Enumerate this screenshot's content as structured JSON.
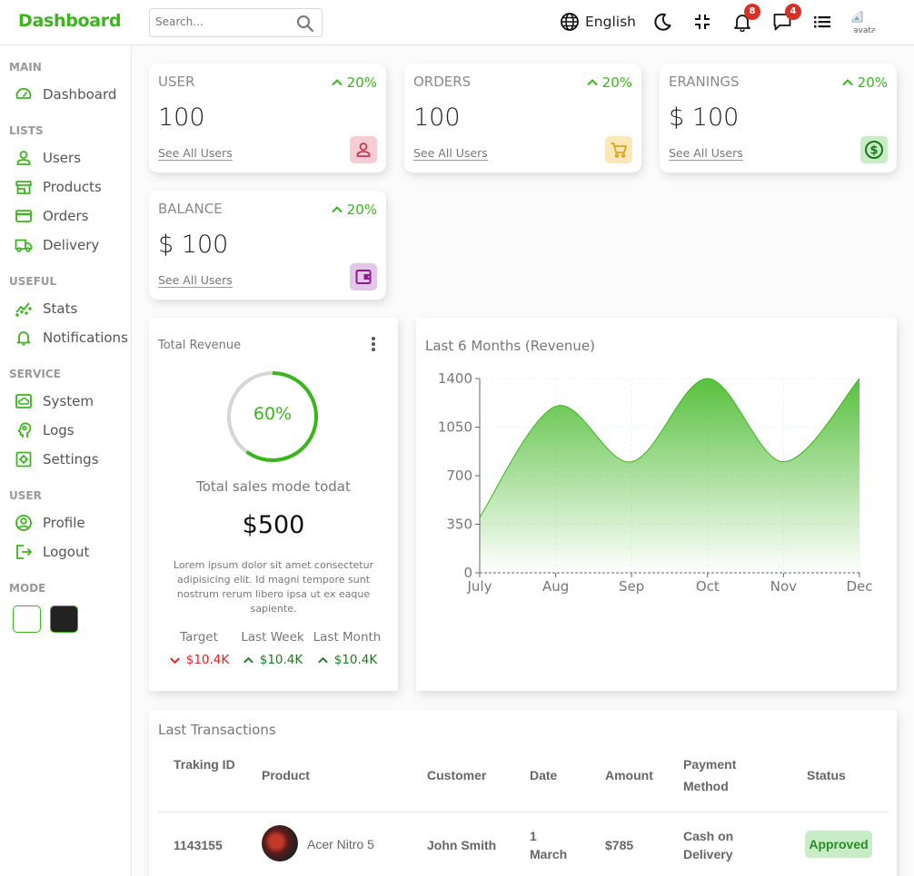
{
  "header": {
    "logo": "Dashboard",
    "search_placeholder": "Search...",
    "language": "English",
    "notifications_count": "8",
    "messages_count": "4",
    "avatar_alt": "avatar"
  },
  "sidebar": {
    "sections": [
      {
        "title": "MAIN",
        "items": [
          {
            "label": "Dashboard",
            "icon": "dashboard-icon"
          }
        ]
      },
      {
        "title": "LISTS",
        "items": [
          {
            "label": "Users",
            "icon": "user-icon"
          },
          {
            "label": "Products",
            "icon": "store-icon"
          },
          {
            "label": "Orders",
            "icon": "credit-card-icon"
          },
          {
            "label": "Delivery",
            "icon": "truck-icon"
          }
        ]
      },
      {
        "title": "USEFUL",
        "items": [
          {
            "label": "Stats",
            "icon": "stats-icon"
          },
          {
            "label": "Notifications",
            "icon": "bell-icon"
          }
        ]
      },
      {
        "title": "SERVICE",
        "items": [
          {
            "label": "System",
            "icon": "system-icon"
          },
          {
            "label": "Logs",
            "icon": "brain-icon"
          },
          {
            "label": "Settings",
            "icon": "settings-icon"
          }
        ]
      },
      {
        "title": "USER",
        "items": [
          {
            "label": "Profile",
            "icon": "profile-icon"
          },
          {
            "label": "Logout",
            "icon": "logout-icon"
          }
        ]
      },
      {
        "title": "MODE",
        "items": []
      }
    ],
    "mode_colors": [
      "#ffffff",
      "#222222"
    ]
  },
  "widgets": [
    {
      "title": "USER",
      "percent": "20%",
      "value": "100",
      "link": "See All Users",
      "icon": "person-icon",
      "icon_color": "#d1354f",
      "icon_bg": "#f6cdd4"
    },
    {
      "title": "ORDERS",
      "percent": "20%",
      "value": "100",
      "link": "See All Users",
      "icon": "cart-icon",
      "icon_color": "#d9a520",
      "icon_bg": "#fbe8b9"
    },
    {
      "title": "ERANINGS",
      "percent": "20%",
      "value": "$ 100",
      "link": "See All Users",
      "icon": "dollar-icon",
      "icon_color": "#167a16",
      "icon_bg": "#c8ecc6"
    },
    {
      "title": "BALANCE",
      "percent": "20%",
      "value": "$ 100",
      "link": "See All Users",
      "icon": "wallet-icon",
      "icon_color": "#8e1c8e",
      "icon_bg": "#e3c7e8"
    }
  ],
  "revenue": {
    "title": "Total Revenue",
    "progress_percent": 60,
    "progress_label": "60%",
    "subtitle": "Total sales mode todat",
    "amount": "$500",
    "description": "Lorem ipsum dolor sit amet consectetur adipisicing elit. Id magni tempore sunt nostrum rerum libero ipsa ut ex eaque sapiente.",
    "summary": [
      {
        "label": "Target",
        "value": "$10.4K",
        "trend": "down",
        "color": "#e02020"
      },
      {
        "label": "Last Week",
        "value": "$10.4K",
        "trend": "up",
        "color": "#1f7a1f"
      },
      {
        "label": "Last Month",
        "value": "$10.4K",
        "trend": "up",
        "color": "#1f7a1f"
      }
    ]
  },
  "chart_data": {
    "type": "area",
    "title": "Last 6 Months (Revenue)",
    "categories": [
      "July",
      "Aug",
      "Sep",
      "Oct",
      "Nov",
      "Dec"
    ],
    "values": [
      400,
      1200,
      800,
      1400,
      800,
      1400
    ],
    "yticks": [
      0,
      350,
      700,
      1050,
      1400
    ],
    "ylim": [
      0,
      1400
    ],
    "grid": true,
    "color": "#3bb51c"
  },
  "transactions": {
    "title": "Last Transactions",
    "columns": [
      "Traking ID",
      "Product",
      "Customer",
      "Date",
      "Amount",
      "Payment Method",
      "Status"
    ],
    "rows": [
      {
        "id": "1143155",
        "product": "Acer Nitro 5",
        "customer": "John Smith",
        "date": "1 March",
        "amount": "$785",
        "method": "Cash on Delivery",
        "status": "Approved"
      }
    ]
  }
}
